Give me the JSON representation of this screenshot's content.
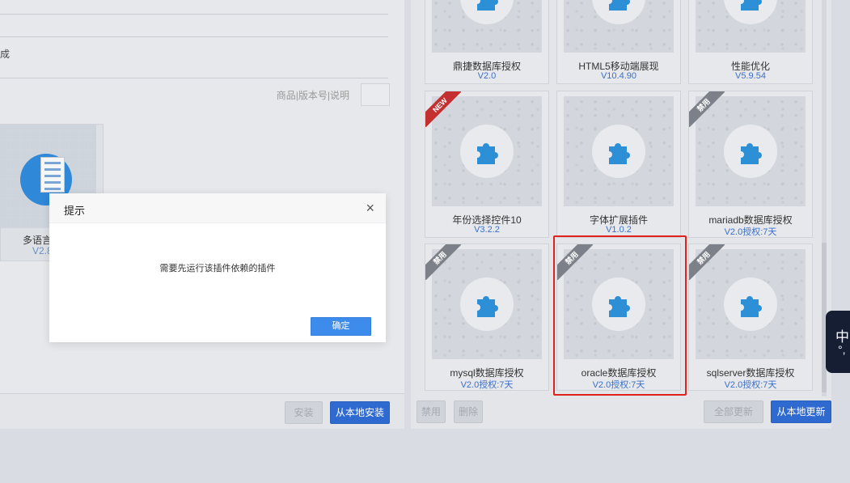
{
  "left": {
    "partial_label": "成",
    "search_placeholder": "商品|版本号|说明",
    "card": {
      "name": "多语言",
      "version": "V2.8"
    },
    "buttons": {
      "install": "安装",
      "install_local": "从本地安装"
    }
  },
  "right": {
    "cards": [
      {
        "name": "鼎捷数据库授权",
        "version": "V2.0",
        "badge": ""
      },
      {
        "name": "HTML5移动端展现",
        "version": "V10.4.90",
        "badge": ""
      },
      {
        "name": "性能优化",
        "version": "V5.9.54",
        "badge": ""
      },
      {
        "name": "年份选择控件10",
        "version": "V3.2.2",
        "badge": "NEW"
      },
      {
        "name": "字体扩展插件",
        "version": "V1.0.2",
        "badge": ""
      },
      {
        "name": "mariadb数据库授权",
        "version": "V2.0授权:7天",
        "badge": "禁用"
      },
      {
        "name": "mysql数据库授权",
        "version": "V2.0授权:7天",
        "badge": "禁用"
      },
      {
        "name": "oracle数据库授权",
        "version": "V2.0授权:7天",
        "badge": "禁用"
      },
      {
        "name": "sqlserver数据库授权",
        "version": "V2.0授权:7天",
        "badge": "禁用"
      }
    ],
    "buttons": {
      "disable": "禁用",
      "delete": "删除",
      "update_all": "全部更新",
      "update_local": "从本地更新"
    }
  },
  "modal": {
    "title": "提示",
    "close_glyph": "×",
    "message": "需要先运行该插件依赖的插件",
    "ok_label": "确定"
  },
  "ime": {
    "char": "中",
    "punct": "°,"
  },
  "colors": {
    "accent": "#2f6ad0",
    "modal_ok": "#3d8bea",
    "highlight": "#e0241d",
    "new_ribbon": "#c43030",
    "disabled_ribbon": "#7c8088",
    "plugin_icon": "#2d8fd6"
  }
}
